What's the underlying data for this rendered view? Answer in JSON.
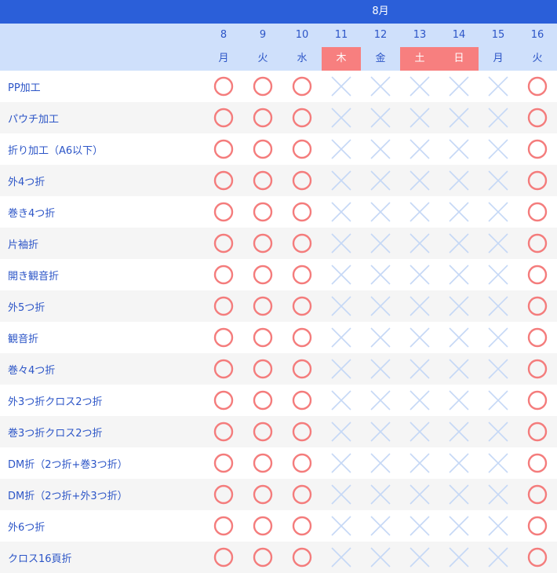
{
  "month_label": "8月",
  "colors": {
    "month_bar": "#2b5fd9",
    "header_bg": "#cfe0fb",
    "weekend_bg": "#f77f7f",
    "label_text": "#2c55c7",
    "available_mark": "#f47c7c",
    "unavailable_mark": "#c5d8f6",
    "alt_row_bg": "#f5f5f5"
  },
  "dates": [
    {
      "day": "8",
      "weekday": "月",
      "highlight": false
    },
    {
      "day": "9",
      "weekday": "火",
      "highlight": false
    },
    {
      "day": "10",
      "weekday": "水",
      "highlight": false
    },
    {
      "day": "11",
      "weekday": "木",
      "highlight": true
    },
    {
      "day": "12",
      "weekday": "金",
      "highlight": false
    },
    {
      "day": "13",
      "weekday": "土",
      "highlight": true
    },
    {
      "day": "14",
      "weekday": "日",
      "highlight": true
    },
    {
      "day": "15",
      "weekday": "月",
      "highlight": false
    },
    {
      "day": "16",
      "weekday": "火",
      "highlight": false
    }
  ],
  "mark_legend": {
    "o": "circle-icon",
    "x": "cross-icon"
  },
  "rows": [
    {
      "label": "PP加工",
      "marks": [
        "o",
        "o",
        "o",
        "x",
        "x",
        "x",
        "x",
        "x",
        "o"
      ]
    },
    {
      "label": "パウチ加工",
      "marks": [
        "o",
        "o",
        "o",
        "x",
        "x",
        "x",
        "x",
        "x",
        "o"
      ]
    },
    {
      "label": "折り加工（A6以下）",
      "marks": [
        "o",
        "o",
        "o",
        "x",
        "x",
        "x",
        "x",
        "x",
        "o"
      ]
    },
    {
      "label": "外4つ折",
      "marks": [
        "o",
        "o",
        "o",
        "x",
        "x",
        "x",
        "x",
        "x",
        "o"
      ]
    },
    {
      "label": "巻き4つ折",
      "marks": [
        "o",
        "o",
        "o",
        "x",
        "x",
        "x",
        "x",
        "x",
        "o"
      ]
    },
    {
      "label": "片袖折",
      "marks": [
        "o",
        "o",
        "o",
        "x",
        "x",
        "x",
        "x",
        "x",
        "o"
      ]
    },
    {
      "label": "開き観音折",
      "marks": [
        "o",
        "o",
        "o",
        "x",
        "x",
        "x",
        "x",
        "x",
        "o"
      ]
    },
    {
      "label": "外5つ折",
      "marks": [
        "o",
        "o",
        "o",
        "x",
        "x",
        "x",
        "x",
        "x",
        "o"
      ]
    },
    {
      "label": "観音折",
      "marks": [
        "o",
        "o",
        "o",
        "x",
        "x",
        "x",
        "x",
        "x",
        "o"
      ]
    },
    {
      "label": "巻々4つ折",
      "marks": [
        "o",
        "o",
        "o",
        "x",
        "x",
        "x",
        "x",
        "x",
        "o"
      ]
    },
    {
      "label": "外3つ折クロス2つ折",
      "marks": [
        "o",
        "o",
        "o",
        "x",
        "x",
        "x",
        "x",
        "x",
        "o"
      ]
    },
    {
      "label": "巻3つ折クロス2つ折",
      "marks": [
        "o",
        "o",
        "o",
        "x",
        "x",
        "x",
        "x",
        "x",
        "o"
      ]
    },
    {
      "label": "DM折（2つ折+巻3つ折）",
      "marks": [
        "o",
        "o",
        "o",
        "x",
        "x",
        "x",
        "x",
        "x",
        "o"
      ]
    },
    {
      "label": "DM折（2つ折+外3つ折）",
      "marks": [
        "o",
        "o",
        "o",
        "x",
        "x",
        "x",
        "x",
        "x",
        "o"
      ]
    },
    {
      "label": "外6つ折",
      "marks": [
        "o",
        "o",
        "o",
        "x",
        "x",
        "x",
        "x",
        "x",
        "o"
      ]
    },
    {
      "label": "クロス16頁折",
      "marks": [
        "o",
        "o",
        "o",
        "x",
        "x",
        "x",
        "x",
        "x",
        "o"
      ]
    }
  ]
}
